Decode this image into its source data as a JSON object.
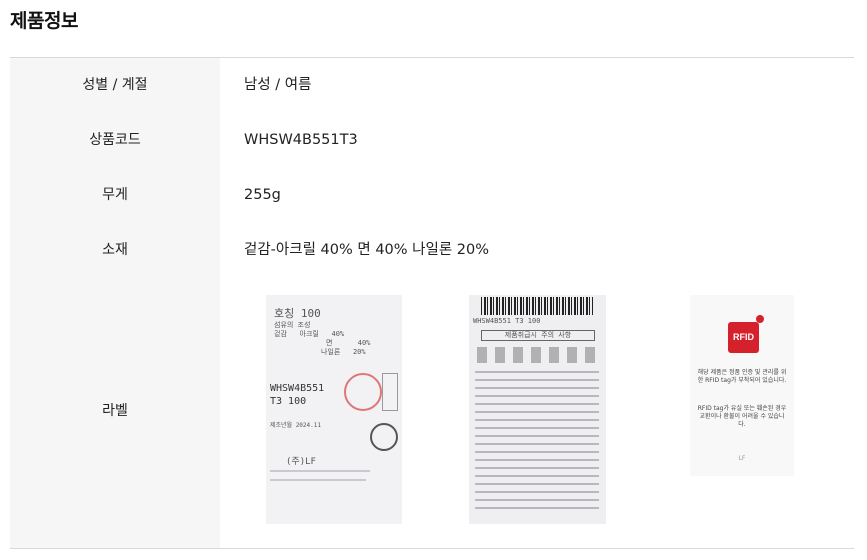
{
  "section_title": "제품정보",
  "specs": [
    {
      "label": "성별 / 계절",
      "value": "남성 / 여름"
    },
    {
      "label": "상품코드",
      "value": "WHSW4B551T3"
    },
    {
      "label": "무게",
      "value": "255g"
    },
    {
      "label": "소재",
      "value": "겉감-아크릴 40% 면 40% 나일론 20%"
    }
  ],
  "label_row": {
    "label": "라벨"
  },
  "care_label_1": {
    "size": "호칭   100",
    "lines": [
      "섬유의 조성",
      "겉감   아크릴   40%",
      "면      40%",
      "나일론   20%"
    ],
    "code": "WHSW4B551",
    "code2": "T3 100",
    "made": "제조년월 2024.11",
    "maker": "(주)LF"
  },
  "care_label_2": {
    "code": "WHSW4B551 T3 100",
    "title": "제품취급시 주의 사항"
  },
  "rfid_card": {
    "badge": "RFID",
    "text1": "해당 제품은 정품 인증 및 관리를 위한 RFID tag가 부착되어 있습니다.",
    "text2": "RFID tag가 유실 또는 훼손된 경우 교환이나 환불이 어려울 수 있습니다.",
    "brand": "LF"
  }
}
